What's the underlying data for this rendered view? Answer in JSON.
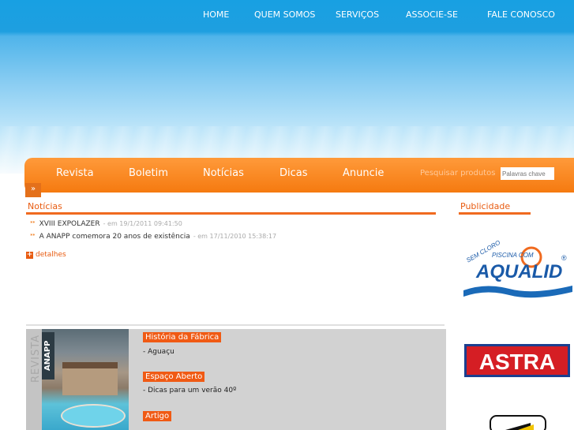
{
  "top_nav": [
    "HOME",
    "QUEM SOMOS",
    "SERVIÇOS",
    "ASSOCIE-SE",
    "FALE CONOSCO"
  ],
  "main_nav": [
    "Revista",
    "Boletim",
    "Notícias",
    "Dicas",
    "Anuncie"
  ],
  "search": {
    "label": "Pesquisar produtos",
    "placeholder": "Palavras chave"
  },
  "raquo": "»",
  "news": {
    "title": "Notícias",
    "items": [
      {
        "title": "XVIII EXPOLAZER",
        "date": "- em 19/1/2011 09:41:50"
      },
      {
        "title": "A ANAPP comemora 20 anos de existência",
        "date": "- em 17/11/2010 15:38:17"
      }
    ],
    "details_label": "detalhes"
  },
  "ads": {
    "title": "Publicidade",
    "aqualid": {
      "top": "SEM CLORO",
      "sub": "PISCINA COM",
      "brand": "AQUALID",
      "reg": "®"
    },
    "astra": "ASTRA"
  },
  "magazine": {
    "side_label": "REVISTA",
    "logo": "ANAPP",
    "sections": [
      {
        "tag": "História da Fábrica",
        "desc": "- Aguaçu"
      },
      {
        "tag": "Espaço Aberto",
        "desc": "- Dicas para um verão 40º"
      },
      {
        "tag": "Artigo",
        "desc": ""
      }
    ]
  },
  "colors": {
    "accent": "#f06a1f",
    "sky": "#1e9fe0",
    "tag_bg": "#f05a14"
  }
}
